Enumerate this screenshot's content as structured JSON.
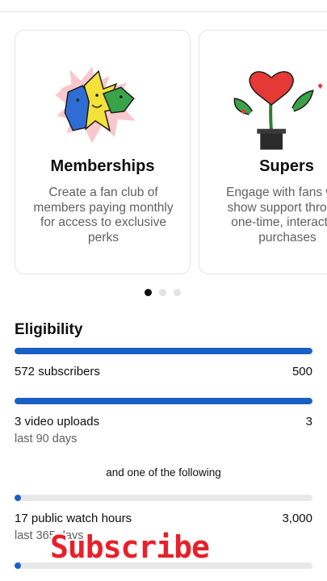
{
  "cards": [
    {
      "title": "Memberships",
      "description": "Create a fan club of members paying monthly for access to exclusive perks",
      "icon": "memberships-illustration-icon"
    },
    {
      "title": "Supers",
      "description": "Engage with fans who show support through one-time, interactive purchases",
      "icon": "supers-plant-heart-icon"
    }
  ],
  "carousel": {
    "page_count": 3,
    "active_index": 0
  },
  "eligibility": {
    "title": "Eligibility",
    "requirements": [
      {
        "label": "572 subscribers",
        "target": "500",
        "sub": "",
        "progress": 1.0
      },
      {
        "label": "3 video uploads",
        "target": "3",
        "sub": "last 90 days",
        "progress": 1.0
      }
    ],
    "or_text": "and one of the following",
    "alternatives": [
      {
        "label": "17 public watch hours",
        "target": "3,000",
        "sub": "last 365 days",
        "progress": 0.006
      },
      {
        "label": "",
        "target": "",
        "sub": "",
        "progress": 0.006
      }
    ]
  },
  "overlay": {
    "watermark": "Subscribe"
  },
  "colors": {
    "progress": "#1a5fc4",
    "track": "#e8e8e8",
    "accent_red": "#e8202a"
  }
}
